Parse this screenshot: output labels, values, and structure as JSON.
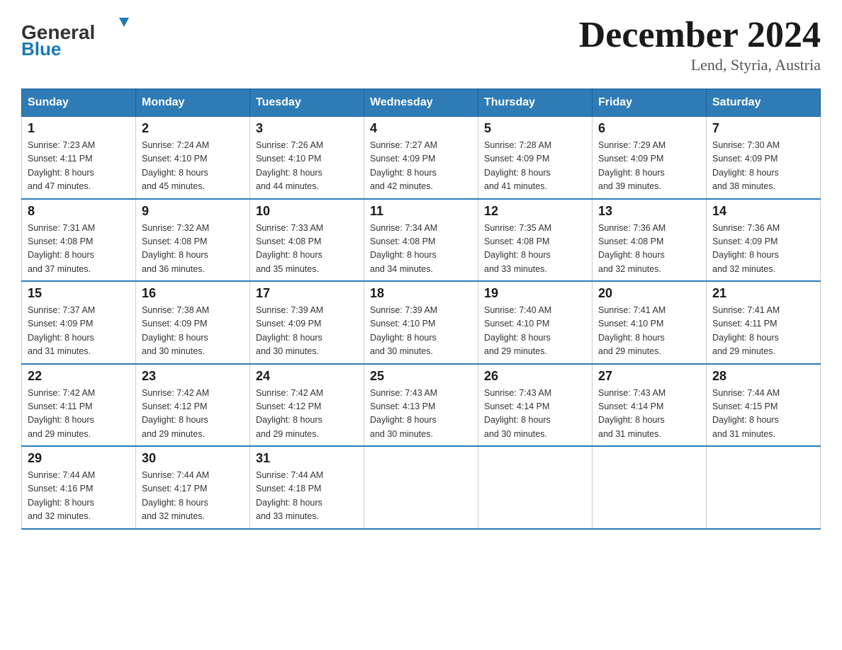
{
  "header": {
    "logo_line1": "General",
    "logo_line2": "Blue",
    "title": "December 2024",
    "subtitle": "Lend, Styria, Austria"
  },
  "weekdays": [
    "Sunday",
    "Monday",
    "Tuesday",
    "Wednesday",
    "Thursday",
    "Friday",
    "Saturday"
  ],
  "weeks": [
    [
      {
        "day": "1",
        "sunrise": "7:23 AM",
        "sunset": "4:11 PM",
        "daylight": "8 hours and 47 minutes."
      },
      {
        "day": "2",
        "sunrise": "7:24 AM",
        "sunset": "4:10 PM",
        "daylight": "8 hours and 45 minutes."
      },
      {
        "day": "3",
        "sunrise": "7:26 AM",
        "sunset": "4:10 PM",
        "daylight": "8 hours and 44 minutes."
      },
      {
        "day": "4",
        "sunrise": "7:27 AM",
        "sunset": "4:09 PM",
        "daylight": "8 hours and 42 minutes."
      },
      {
        "day": "5",
        "sunrise": "7:28 AM",
        "sunset": "4:09 PM",
        "daylight": "8 hours and 41 minutes."
      },
      {
        "day": "6",
        "sunrise": "7:29 AM",
        "sunset": "4:09 PM",
        "daylight": "8 hours and 39 minutes."
      },
      {
        "day": "7",
        "sunrise": "7:30 AM",
        "sunset": "4:09 PM",
        "daylight": "8 hours and 38 minutes."
      }
    ],
    [
      {
        "day": "8",
        "sunrise": "7:31 AM",
        "sunset": "4:08 PM",
        "daylight": "8 hours and 37 minutes."
      },
      {
        "day": "9",
        "sunrise": "7:32 AM",
        "sunset": "4:08 PM",
        "daylight": "8 hours and 36 minutes."
      },
      {
        "day": "10",
        "sunrise": "7:33 AM",
        "sunset": "4:08 PM",
        "daylight": "8 hours and 35 minutes."
      },
      {
        "day": "11",
        "sunrise": "7:34 AM",
        "sunset": "4:08 PM",
        "daylight": "8 hours and 34 minutes."
      },
      {
        "day": "12",
        "sunrise": "7:35 AM",
        "sunset": "4:08 PM",
        "daylight": "8 hours and 33 minutes."
      },
      {
        "day": "13",
        "sunrise": "7:36 AM",
        "sunset": "4:08 PM",
        "daylight": "8 hours and 32 minutes."
      },
      {
        "day": "14",
        "sunrise": "7:36 AM",
        "sunset": "4:09 PM",
        "daylight": "8 hours and 32 minutes."
      }
    ],
    [
      {
        "day": "15",
        "sunrise": "7:37 AM",
        "sunset": "4:09 PM",
        "daylight": "8 hours and 31 minutes."
      },
      {
        "day": "16",
        "sunrise": "7:38 AM",
        "sunset": "4:09 PM",
        "daylight": "8 hours and 30 minutes."
      },
      {
        "day": "17",
        "sunrise": "7:39 AM",
        "sunset": "4:09 PM",
        "daylight": "8 hours and 30 minutes."
      },
      {
        "day": "18",
        "sunrise": "7:39 AM",
        "sunset": "4:10 PM",
        "daylight": "8 hours and 30 minutes."
      },
      {
        "day": "19",
        "sunrise": "7:40 AM",
        "sunset": "4:10 PM",
        "daylight": "8 hours and 29 minutes."
      },
      {
        "day": "20",
        "sunrise": "7:41 AM",
        "sunset": "4:10 PM",
        "daylight": "8 hours and 29 minutes."
      },
      {
        "day": "21",
        "sunrise": "7:41 AM",
        "sunset": "4:11 PM",
        "daylight": "8 hours and 29 minutes."
      }
    ],
    [
      {
        "day": "22",
        "sunrise": "7:42 AM",
        "sunset": "4:11 PM",
        "daylight": "8 hours and 29 minutes."
      },
      {
        "day": "23",
        "sunrise": "7:42 AM",
        "sunset": "4:12 PM",
        "daylight": "8 hours and 29 minutes."
      },
      {
        "day": "24",
        "sunrise": "7:42 AM",
        "sunset": "4:12 PM",
        "daylight": "8 hours and 29 minutes."
      },
      {
        "day": "25",
        "sunrise": "7:43 AM",
        "sunset": "4:13 PM",
        "daylight": "8 hours and 30 minutes."
      },
      {
        "day": "26",
        "sunrise": "7:43 AM",
        "sunset": "4:14 PM",
        "daylight": "8 hours and 30 minutes."
      },
      {
        "day": "27",
        "sunrise": "7:43 AM",
        "sunset": "4:14 PM",
        "daylight": "8 hours and 31 minutes."
      },
      {
        "day": "28",
        "sunrise": "7:44 AM",
        "sunset": "4:15 PM",
        "daylight": "8 hours and 31 minutes."
      }
    ],
    [
      {
        "day": "29",
        "sunrise": "7:44 AM",
        "sunset": "4:16 PM",
        "daylight": "8 hours and 32 minutes."
      },
      {
        "day": "30",
        "sunrise": "7:44 AM",
        "sunset": "4:17 PM",
        "daylight": "8 hours and 32 minutes."
      },
      {
        "day": "31",
        "sunrise": "7:44 AM",
        "sunset": "4:18 PM",
        "daylight": "8 hours and 33 minutes."
      },
      null,
      null,
      null,
      null
    ]
  ],
  "labels": {
    "sunrise": "Sunrise:",
    "sunset": "Sunset:",
    "daylight": "Daylight:"
  },
  "colors": {
    "header_bg": "#2e7bb5",
    "border": "#ccc",
    "row_border": "#2e7bb5"
  }
}
